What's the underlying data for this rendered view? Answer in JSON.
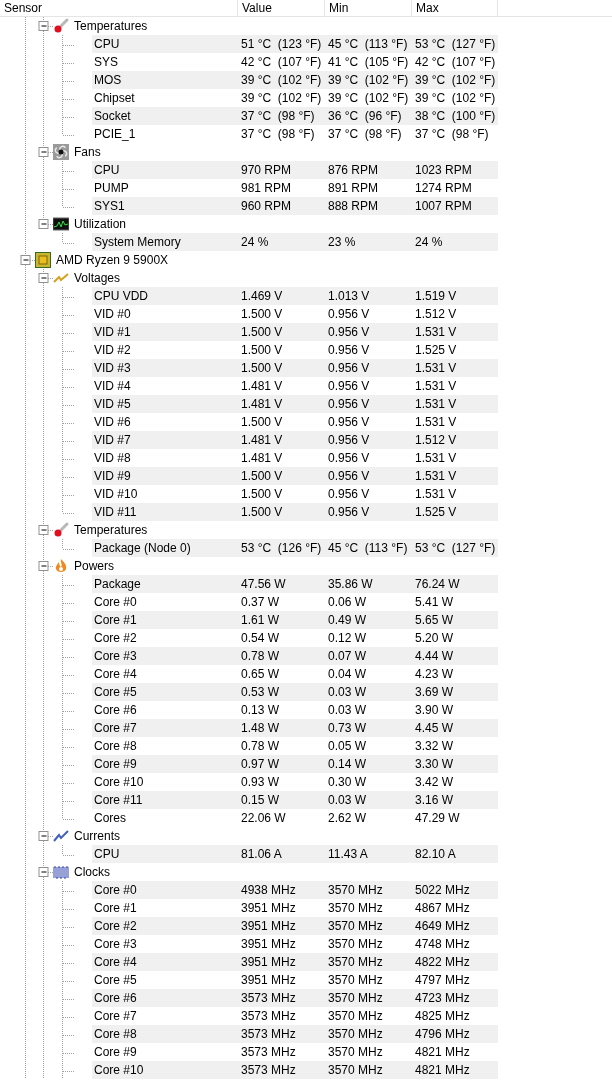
{
  "columns": [
    "Sensor",
    "Value",
    "Min",
    "Max"
  ],
  "tree": [
    {
      "children": [
        {
          "kind": "temperature",
          "label": "Temperatures",
          "expanded": true,
          "children": [
            {
              "label": "CPU",
              "value": "51 °C  (123 °F)",
              "min": "45 °C  (113 °F)",
              "max": "53 °C  (127 °F)"
            },
            {
              "label": "SYS",
              "value": "42 °C  (107 °F)",
              "min": "41 °C  (105 °F)",
              "max": "42 °C  (107 °F)"
            },
            {
              "label": "MOS",
              "value": "39 °C  (102 °F)",
              "min": "39 °C  (102 °F)",
              "max": "39 °C  (102 °F)"
            },
            {
              "label": "Chipset",
              "value": "39 °C  (102 °F)",
              "min": "39 °C  (102 °F)",
              "max": "39 °C  (102 °F)"
            },
            {
              "label": "Socket",
              "value": "37 °C  (98 °F)",
              "min": "36 °C  (96 °F)",
              "max": "38 °C  (100 °F)"
            },
            {
              "label": "PCIE_1",
              "value": "37 °C  (98 °F)",
              "min": "37 °C  (98 °F)",
              "max": "37 °C  (98 °F)"
            }
          ]
        },
        {
          "kind": "fan",
          "label": "Fans",
          "expanded": true,
          "children": [
            {
              "label": "CPU",
              "value": "970 RPM",
              "min": "876 RPM",
              "max": "1023 RPM"
            },
            {
              "label": "PUMP",
              "value": "981 RPM",
              "min": "891 RPM",
              "max": "1274 RPM"
            },
            {
              "label": "SYS1",
              "value": "960 RPM",
              "min": "888 RPM",
              "max": "1007 RPM"
            }
          ]
        },
        {
          "kind": "utilization",
          "label": "Utilization",
          "expanded": true,
          "children": [
            {
              "label": "System Memory",
              "value": "24 %",
              "min": "23 %",
              "max": "24 %"
            }
          ]
        }
      ]
    },
    {
      "label": "AMD Ryzen 9 5900X",
      "expanded": true,
      "children": [
        {
          "kind": "voltage",
          "label": "Voltages",
          "expanded": true,
          "children": [
            {
              "label": "CPU VDD",
              "value": "1.469 V",
              "min": "1.013 V",
              "max": "1.519 V"
            },
            {
              "label": "VID #0",
              "value": "1.500 V",
              "min": "0.956 V",
              "max": "1.512 V"
            },
            {
              "label": "VID #1",
              "value": "1.500 V",
              "min": "0.956 V",
              "max": "1.531 V"
            },
            {
              "label": "VID #2",
              "value": "1.500 V",
              "min": "0.956 V",
              "max": "1.525 V"
            },
            {
              "label": "VID #3",
              "value": "1.500 V",
              "min": "0.956 V",
              "max": "1.531 V"
            },
            {
              "label": "VID #4",
              "value": "1.481 V",
              "min": "0.956 V",
              "max": "1.531 V"
            },
            {
              "label": "VID #5",
              "value": "1.481 V",
              "min": "0.956 V",
              "max": "1.531 V"
            },
            {
              "label": "VID #6",
              "value": "1.500 V",
              "min": "0.956 V",
              "max": "1.531 V"
            },
            {
              "label": "VID #7",
              "value": "1.481 V",
              "min": "0.956 V",
              "max": "1.512 V"
            },
            {
              "label": "VID #8",
              "value": "1.481 V",
              "min": "0.956 V",
              "max": "1.531 V"
            },
            {
              "label": "VID #9",
              "value": "1.500 V",
              "min": "0.956 V",
              "max": "1.531 V"
            },
            {
              "label": "VID #10",
              "value": "1.500 V",
              "min": "0.956 V",
              "max": "1.531 V"
            },
            {
              "label": "VID #11",
              "value": "1.500 V",
              "min": "0.956 V",
              "max": "1.525 V"
            }
          ]
        },
        {
          "kind": "temperature",
          "label": "Temperatures",
          "expanded": true,
          "children": [
            {
              "label": "Package (Node 0)",
              "value": "53 °C  (126 °F)",
              "min": "45 °C  (113 °F)",
              "max": "53 °C  (127 °F)"
            }
          ]
        },
        {
          "kind": "power",
          "label": "Powers",
          "expanded": true,
          "children": [
            {
              "label": "Package",
              "value": "47.56 W",
              "min": "35.86 W",
              "max": "76.24 W"
            },
            {
              "label": "Core #0",
              "value": "0.37 W",
              "min": "0.06 W",
              "max": "5.41 W"
            },
            {
              "label": "Core #1",
              "value": "1.61 W",
              "min": "0.49 W",
              "max": "5.65 W"
            },
            {
              "label": "Core #2",
              "value": "0.54 W",
              "min": "0.12 W",
              "max": "5.20 W"
            },
            {
              "label": "Core #3",
              "value": "0.78 W",
              "min": "0.07 W",
              "max": "4.44 W"
            },
            {
              "label": "Core #4",
              "value": "0.65 W",
              "min": "0.04 W",
              "max": "4.23 W"
            },
            {
              "label": "Core #5",
              "value": "0.53 W",
              "min": "0.03 W",
              "max": "3.69 W"
            },
            {
              "label": "Core #6",
              "value": "0.13 W",
              "min": "0.03 W",
              "max": "3.90 W"
            },
            {
              "label": "Core #7",
              "value": "1.48 W",
              "min": "0.73 W",
              "max": "4.45 W"
            },
            {
              "label": "Core #8",
              "value": "0.78 W",
              "min": "0.05 W",
              "max": "3.32 W"
            },
            {
              "label": "Core #9",
              "value": "0.97 W",
              "min": "0.14 W",
              "max": "3.30 W"
            },
            {
              "label": "Core #10",
              "value": "0.93 W",
              "min": "0.30 W",
              "max": "3.42 W"
            },
            {
              "label": "Core #11",
              "value": "0.15 W",
              "min": "0.03 W",
              "max": "3.16 W"
            },
            {
              "label": "Cores",
              "value": "22.06 W",
              "min": "2.62 W",
              "max": "47.29 W"
            }
          ]
        },
        {
          "kind": "current",
          "label": "Currents",
          "expanded": true,
          "children": [
            {
              "label": "CPU",
              "value": "81.06 A",
              "min": "11.43 A",
              "max": "82.10 A"
            }
          ]
        },
        {
          "kind": "clock",
          "label": "Clocks",
          "expanded": true,
          "children": [
            {
              "label": "Core #0",
              "value": "4938 MHz",
              "min": "3570 MHz",
              "max": "5022 MHz"
            },
            {
              "label": "Core #1",
              "value": "3951 MHz",
              "min": "3570 MHz",
              "max": "4867 MHz"
            },
            {
              "label": "Core #2",
              "value": "3951 MHz",
              "min": "3570 MHz",
              "max": "4649 MHz"
            },
            {
              "label": "Core #3",
              "value": "3951 MHz",
              "min": "3570 MHz",
              "max": "4748 MHz"
            },
            {
              "label": "Core #4",
              "value": "3951 MHz",
              "min": "3570 MHz",
              "max": "4822 MHz"
            },
            {
              "label": "Core #5",
              "value": "3951 MHz",
              "min": "3570 MHz",
              "max": "4797 MHz"
            },
            {
              "label": "Core #6",
              "value": "3573 MHz",
              "min": "3570 MHz",
              "max": "4723 MHz"
            },
            {
              "label": "Core #7",
              "value": "3573 MHz",
              "min": "3570 MHz",
              "max": "4825 MHz"
            },
            {
              "label": "Core #8",
              "value": "3573 MHz",
              "min": "3570 MHz",
              "max": "4796 MHz"
            },
            {
              "label": "Core #9",
              "value": "3573 MHz",
              "min": "3570 MHz",
              "max": "4821 MHz"
            },
            {
              "label": "Core #10",
              "value": "3573 MHz",
              "min": "3570 MHz",
              "max": "4821 MHz"
            }
          ]
        }
      ]
    }
  ]
}
